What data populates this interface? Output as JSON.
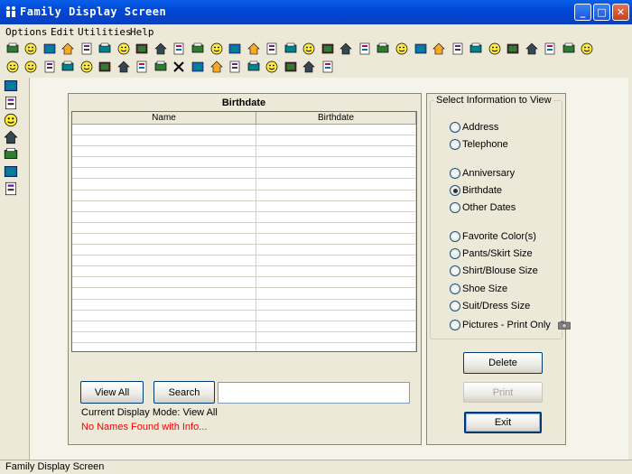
{
  "window": {
    "title": "Family Display Screen"
  },
  "menu": [
    "Options",
    "Edit",
    "Utilities",
    "Help"
  ],
  "toolbar1": [
    "printer-icon",
    "book-green-icon",
    "book-open-icon",
    "flag-icon",
    "house-icon",
    "family-icon",
    "first-aid-icon",
    "pen-icon",
    "car-icon",
    "folder-icon",
    "calendar-icon",
    "gift-icon",
    "screen-blue-icon",
    "screen-blue2-icon",
    "screen-blue3-icon",
    "screen-blue4-icon",
    "tree-icon",
    "sofa-red-icon",
    "car-blue-icon",
    "telescope-icon",
    "books-icon",
    "house2-icon",
    "building-icon",
    "bird-icon",
    "sofa2-icon",
    "picture-icon",
    "ornament-icon",
    "cube-icon",
    "shoe-icon",
    "cake-icon",
    "shoe2-icon",
    "iron-icon"
  ],
  "toolbar2": [
    "smiley-icon",
    "smiley2-icon",
    "people-icon",
    "baby-icon",
    "document-icon",
    "building2-icon",
    "calendar-grid-icon",
    "key-icon",
    "person-icon",
    "close-x-icon",
    "grid-icon",
    "book-cyan-icon",
    "nbg-icon",
    "dog-icon",
    "cartoon-icon",
    "globe-icon",
    "help-icon",
    "exit-icon"
  ],
  "sidebar": [
    "grid-view-icon",
    "text-a-icon",
    "note-icon",
    "copy-disabled-icon",
    "printer-icon",
    "help-icon",
    "exit-icon"
  ],
  "grid": {
    "title": "Birthdate",
    "columns": [
      "Name",
      "Birthdate"
    ],
    "rows": []
  },
  "buttons": {
    "view_all": "View All",
    "search": "Search",
    "delete": "Delete",
    "print": "Print",
    "exit": "Exit"
  },
  "status": {
    "mode": "Current Display Mode: View All",
    "none": "No Names Found with Info..."
  },
  "info_group": {
    "legend": "Select Information to View",
    "options": [
      {
        "label": "Address",
        "selected": false
      },
      {
        "label": "Telephone",
        "selected": false
      },
      {
        "label": "Anniversary",
        "selected": false
      },
      {
        "label": "Birthdate",
        "selected": true
      },
      {
        "label": "Other Dates",
        "selected": false
      },
      {
        "label": "Favorite Color(s)",
        "selected": false
      },
      {
        "label": "Pants/Skirt Size",
        "selected": false
      },
      {
        "label": "Shirt/Blouse Size",
        "selected": false
      },
      {
        "label": "Shoe Size",
        "selected": false
      },
      {
        "label": "Suit/Dress Size",
        "selected": false
      },
      {
        "label": "Pictures - Print Only",
        "selected": false
      }
    ]
  },
  "statusbar": "Family Display Screen",
  "colors": {
    "titlebar": "#0048d8",
    "accent_red": "#ff0000"
  }
}
